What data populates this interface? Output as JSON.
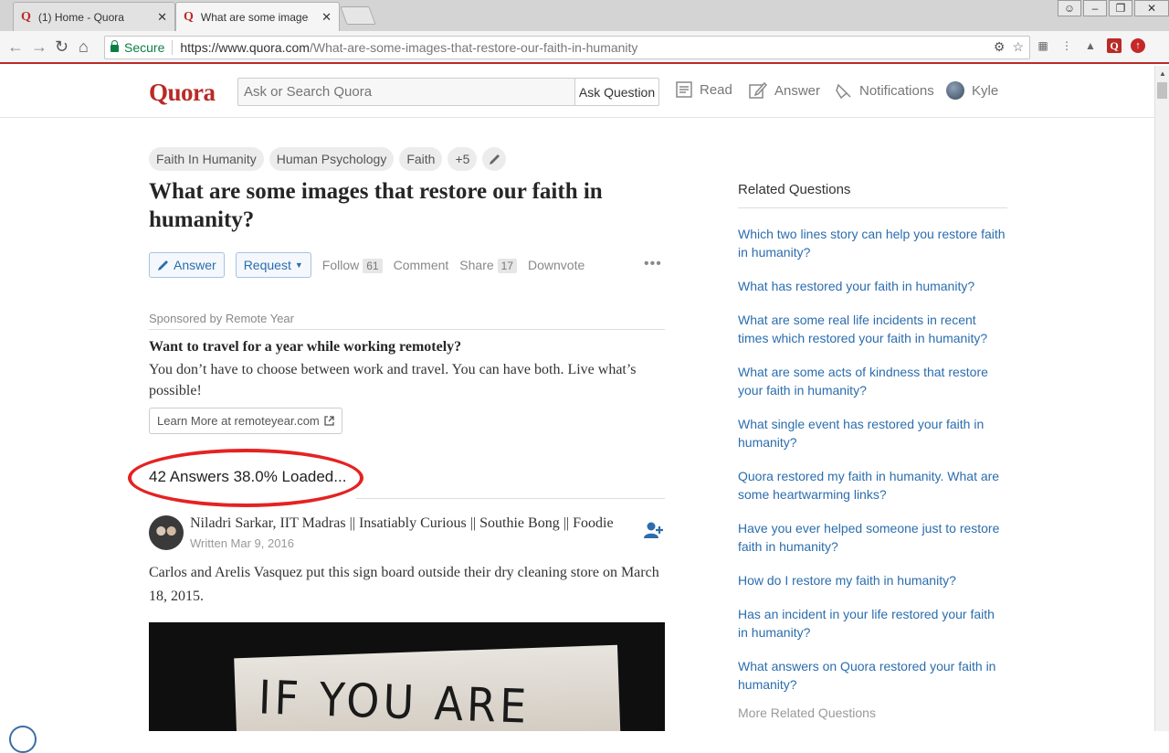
{
  "browser": {
    "tabs": [
      {
        "favicon": "Q",
        "title": "(1) Home - Quora",
        "close": "✕"
      },
      {
        "favicon": "Q",
        "title": "What are some images that restore our faith in humanity",
        "close": "✕"
      }
    ],
    "secure_label": "Secure",
    "url_base": "https://www.quora.com",
    "url_path": "/What-are-some-images-that-restore-our-faith-in-humanity"
  },
  "header": {
    "logo": "Quora",
    "search_placeholder": "Ask or Search Quora",
    "ask_button": "Ask Question",
    "nav": {
      "read": "Read",
      "answer": "Answer",
      "notifications": "Notifications",
      "user": "Kyle"
    }
  },
  "question": {
    "topics": [
      "Faith In Humanity",
      "Human Psychology",
      "Faith",
      "+5"
    ],
    "title": "What are some images that restore our faith in humanity?",
    "actions": {
      "answer": "Answer",
      "request": "Request",
      "follow": "Follow",
      "follow_count": "61",
      "comment": "Comment",
      "share": "Share",
      "share_count": "17",
      "downvote": "Downvote",
      "more": "•••"
    }
  },
  "ad": {
    "sponsor": "Sponsored by Remote Year",
    "title": "Want to travel for a year while working remotely?",
    "body": "You don’t have to choose between work and travel. You can have both. Live what’s possible!",
    "button": "Learn More at remoteyear.com"
  },
  "answers": {
    "count_text": "42 Answers 38.0% Loaded...",
    "first": {
      "author": "Niladri Sarkar, IIT Madras || Insatiably Curious || Southie Bong || Foodie",
      "written": "Written Mar 9, 2016",
      "text": "Carlos and Arelis Vasquez put this sign board outside their dry cleaning store on March 18, 2015.",
      "image_text": "IF YOU ARE"
    }
  },
  "sidebar": {
    "title": "Related Questions",
    "items": [
      "Which two lines story can help you restore faith in humanity?",
      "What has restored your faith in humanity?",
      "What are some real life incidents in recent times which restored your faith in humanity?",
      "What are some acts of kindness that restore your faith in humanity?",
      "What single event has restored your faith in humanity?",
      "Quora restored my faith in humanity. What are some heartwarming links?",
      "Have you ever helped someone just to restore faith in humanity?",
      "How do I restore my faith in humanity?",
      "Has an incident in your life restored your faith in humanity?",
      "What answers on Quora restored your faith in humanity?"
    ],
    "more": "More Related Questions"
  },
  "colors": {
    "brand": "#b92b27",
    "link": "#2b6dad",
    "highlight": "#e52222"
  }
}
